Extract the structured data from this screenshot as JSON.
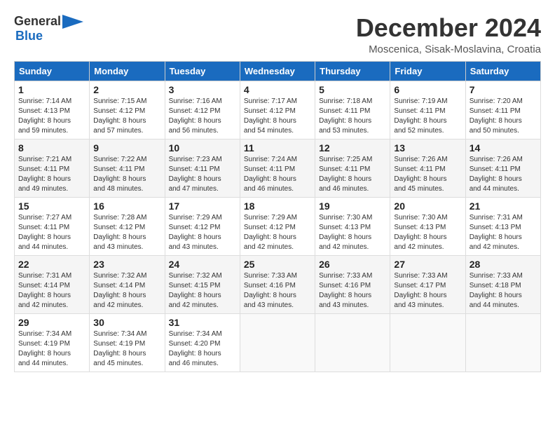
{
  "header": {
    "logo_general": "General",
    "logo_blue": "Blue",
    "month_title": "December 2024",
    "location": "Moscenica, Sisak-Moslavina, Croatia"
  },
  "columns": [
    "Sunday",
    "Monday",
    "Tuesday",
    "Wednesday",
    "Thursday",
    "Friday",
    "Saturday"
  ],
  "weeks": [
    [
      {
        "day": "1",
        "sunrise": "7:14 AM",
        "sunset": "4:13 PM",
        "daylight": "8 hours and 59 minutes."
      },
      {
        "day": "2",
        "sunrise": "7:15 AM",
        "sunset": "4:12 PM",
        "daylight": "8 hours and 57 minutes."
      },
      {
        "day": "3",
        "sunrise": "7:16 AM",
        "sunset": "4:12 PM",
        "daylight": "8 hours and 56 minutes."
      },
      {
        "day": "4",
        "sunrise": "7:17 AM",
        "sunset": "4:12 PM",
        "daylight": "8 hours and 54 minutes."
      },
      {
        "day": "5",
        "sunrise": "7:18 AM",
        "sunset": "4:11 PM",
        "daylight": "8 hours and 53 minutes."
      },
      {
        "day": "6",
        "sunrise": "7:19 AM",
        "sunset": "4:11 PM",
        "daylight": "8 hours and 52 minutes."
      },
      {
        "day": "7",
        "sunrise": "7:20 AM",
        "sunset": "4:11 PM",
        "daylight": "8 hours and 50 minutes."
      }
    ],
    [
      {
        "day": "8",
        "sunrise": "7:21 AM",
        "sunset": "4:11 PM",
        "daylight": "8 hours and 49 minutes."
      },
      {
        "day": "9",
        "sunrise": "7:22 AM",
        "sunset": "4:11 PM",
        "daylight": "8 hours and 48 minutes."
      },
      {
        "day": "10",
        "sunrise": "7:23 AM",
        "sunset": "4:11 PM",
        "daylight": "8 hours and 47 minutes."
      },
      {
        "day": "11",
        "sunrise": "7:24 AM",
        "sunset": "4:11 PM",
        "daylight": "8 hours and 46 minutes."
      },
      {
        "day": "12",
        "sunrise": "7:25 AM",
        "sunset": "4:11 PM",
        "daylight": "8 hours and 46 minutes."
      },
      {
        "day": "13",
        "sunrise": "7:26 AM",
        "sunset": "4:11 PM",
        "daylight": "8 hours and 45 minutes."
      },
      {
        "day": "14",
        "sunrise": "7:26 AM",
        "sunset": "4:11 PM",
        "daylight": "8 hours and 44 minutes."
      }
    ],
    [
      {
        "day": "15",
        "sunrise": "7:27 AM",
        "sunset": "4:11 PM",
        "daylight": "8 hours and 44 minutes."
      },
      {
        "day": "16",
        "sunrise": "7:28 AM",
        "sunset": "4:12 PM",
        "daylight": "8 hours and 43 minutes."
      },
      {
        "day": "17",
        "sunrise": "7:29 AM",
        "sunset": "4:12 PM",
        "daylight": "8 hours and 43 minutes."
      },
      {
        "day": "18",
        "sunrise": "7:29 AM",
        "sunset": "4:12 PM",
        "daylight": "8 hours and 42 minutes."
      },
      {
        "day": "19",
        "sunrise": "7:30 AM",
        "sunset": "4:13 PM",
        "daylight": "8 hours and 42 minutes."
      },
      {
        "day": "20",
        "sunrise": "7:30 AM",
        "sunset": "4:13 PM",
        "daylight": "8 hours and 42 minutes."
      },
      {
        "day": "21",
        "sunrise": "7:31 AM",
        "sunset": "4:13 PM",
        "daylight": "8 hours and 42 minutes."
      }
    ],
    [
      {
        "day": "22",
        "sunrise": "7:31 AM",
        "sunset": "4:14 PM",
        "daylight": "8 hours and 42 minutes."
      },
      {
        "day": "23",
        "sunrise": "7:32 AM",
        "sunset": "4:14 PM",
        "daylight": "8 hours and 42 minutes."
      },
      {
        "day": "24",
        "sunrise": "7:32 AM",
        "sunset": "4:15 PM",
        "daylight": "8 hours and 42 minutes."
      },
      {
        "day": "25",
        "sunrise": "7:33 AM",
        "sunset": "4:16 PM",
        "daylight": "8 hours and 43 minutes."
      },
      {
        "day": "26",
        "sunrise": "7:33 AM",
        "sunset": "4:16 PM",
        "daylight": "8 hours and 43 minutes."
      },
      {
        "day": "27",
        "sunrise": "7:33 AM",
        "sunset": "4:17 PM",
        "daylight": "8 hours and 43 minutes."
      },
      {
        "day": "28",
        "sunrise": "7:33 AM",
        "sunset": "4:18 PM",
        "daylight": "8 hours and 44 minutes."
      }
    ],
    [
      {
        "day": "29",
        "sunrise": "7:34 AM",
        "sunset": "4:19 PM",
        "daylight": "8 hours and 44 minutes."
      },
      {
        "day": "30",
        "sunrise": "7:34 AM",
        "sunset": "4:19 PM",
        "daylight": "8 hours and 45 minutes."
      },
      {
        "day": "31",
        "sunrise": "7:34 AM",
        "sunset": "4:20 PM",
        "daylight": "8 hours and 46 minutes."
      },
      null,
      null,
      null,
      null
    ]
  ],
  "labels": {
    "sunrise": "Sunrise:",
    "sunset": "Sunset:",
    "daylight": "Daylight:"
  }
}
